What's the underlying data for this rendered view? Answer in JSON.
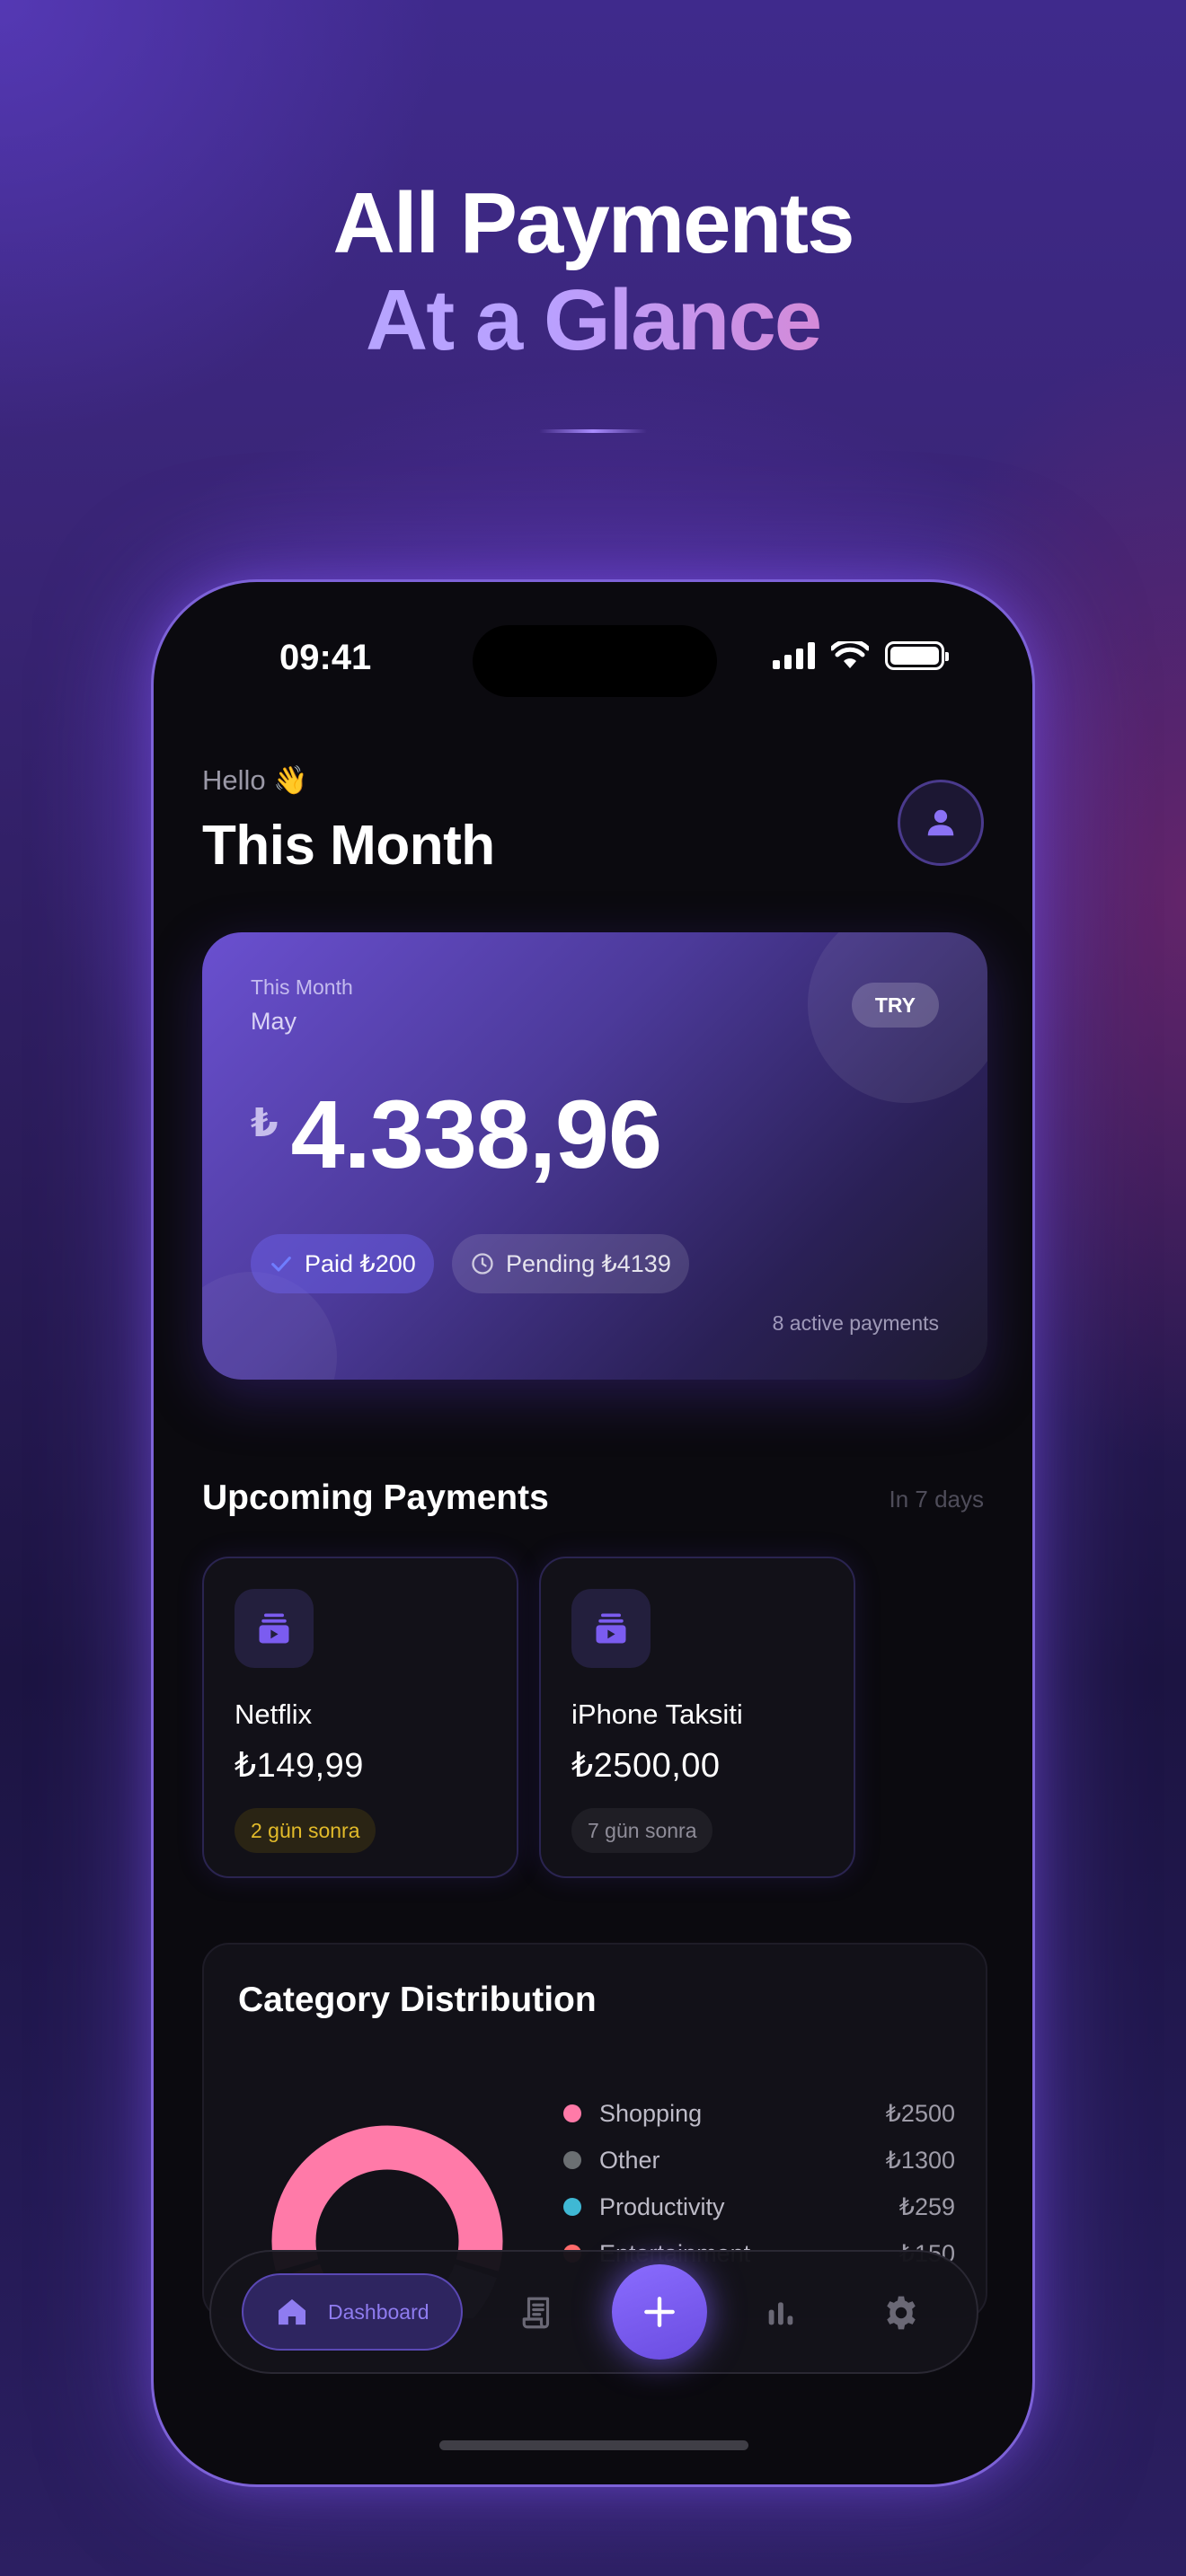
{
  "headline": {
    "line1": "All Payments",
    "line2": "At a Glance"
  },
  "status_bar": {
    "time": "09:41"
  },
  "header": {
    "greeting": "Hello 👋",
    "title": "This Month"
  },
  "summary_card": {
    "label": "This Month",
    "month": "May",
    "currency": "TRY",
    "currency_symbol": "₺",
    "amount": "4.338,96",
    "paid_label": "Paid ₺200",
    "pending_label": "Pending ₺4139",
    "active_payments": "8 active payments"
  },
  "upcoming": {
    "title": "Upcoming Payments",
    "range": "In 7 days",
    "items": [
      {
        "name": "Netflix",
        "amount": "₺149,99",
        "due": "2 gün sonra"
      },
      {
        "name": "iPhone Taksiti",
        "amount": "₺2500,00",
        "due": "7 gün sonra"
      }
    ]
  },
  "category": {
    "title": "Category Distribution",
    "items": [
      {
        "name": "Shopping",
        "amount": "₺2500",
        "color": "#ff7aa8"
      },
      {
        "name": "Other",
        "amount": "₺1300",
        "color": "#6b6f72"
      },
      {
        "name": "Productivity",
        "amount": "₺259",
        "color": "#3fb8d4"
      },
      {
        "name": "Entertainment",
        "amount": "₺150",
        "color": "#ff6b6b"
      }
    ]
  },
  "chart_data": {
    "type": "pie",
    "categories": [
      "Shopping",
      "Other",
      "Productivity",
      "Entertainment"
    ],
    "values": [
      2500,
      1300,
      259,
      150
    ],
    "title": "Category Distribution"
  },
  "nav": {
    "dashboard_label": "Dashboard",
    "accent": "#7b5cf0"
  }
}
